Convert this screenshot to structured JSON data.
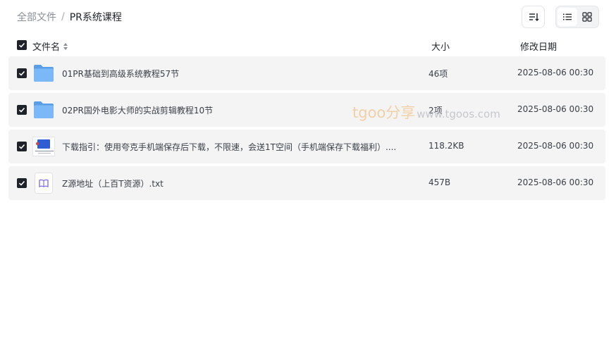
{
  "breadcrumb": {
    "root": "全部文件",
    "separator": "/",
    "current": "PR系统课程"
  },
  "toolbar": {
    "sort_icon": "sort-icon",
    "view_list_icon": "list-view-icon",
    "view_grid_icon": "grid-view-icon",
    "active_view": "list"
  },
  "table": {
    "headers": {
      "name": "文件名",
      "size": "大小",
      "date": "修改日期"
    },
    "rows": [
      {
        "name": "01PR基础到高级系统教程57节",
        "size": "46项",
        "date": "2025-08-06 00:30",
        "type": "folder",
        "checked": true
      },
      {
        "name": "02PR国外电影大师的实战剪辑教程10节",
        "size": "2项",
        "date": "2025-08-06 00:30",
        "type": "folder",
        "checked": true
      },
      {
        "name": "下载指引：使用夸克手机端保存后下载，不限速，会送1T空间（手机端保存下载福利）....",
        "size": "118.2KB",
        "date": "2025-08-06 00:30",
        "type": "image",
        "checked": true
      },
      {
        "name": "Z源地址（上百T资源）.txt",
        "size": "457B",
        "date": "2025-08-06 00:30",
        "type": "txt",
        "checked": true
      }
    ]
  },
  "watermark": {
    "main": "tgoo分享",
    "sub": "www.tgoos.com"
  },
  "colors": {
    "folder": "#6fb0f5",
    "folder_dark": "#5a9ee8",
    "checkbox": "#1f2329",
    "row_bg": "#f4f4f5",
    "txt_icon": "#7b68ee"
  }
}
